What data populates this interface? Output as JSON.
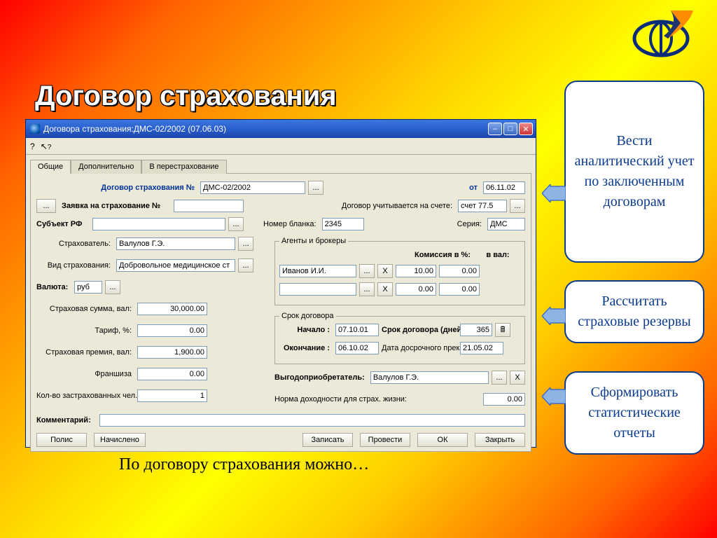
{
  "slide": {
    "title": "Договор страхования",
    "caption": "По договору страхования можно…"
  },
  "callouts": {
    "c1": "Вести аналитический учет по заключенным договорам",
    "c2": "Рассчитать страховые резервы",
    "c3": "Сформировать статистические отчеты"
  },
  "window": {
    "title": "Договора страхования:ДМС-02/2002 (07.06.03)",
    "help_icon": "?",
    "cursor_icon": "↖?"
  },
  "tabs": {
    "t1": "Общие",
    "t2": "Дополнительно",
    "t3": "В перестрахование"
  },
  "labels": {
    "contract_no": "Договор страхования №",
    "from": "от",
    "request_no": "Заявка на страхование №",
    "account": "Договор учитывается на счете:",
    "subject_rf": "Субъект РФ",
    "blank_no": "Номер бланка:",
    "series": "Серия:",
    "insurer": "Страхователь:",
    "type": "Вид страхования:",
    "currency": "Валюта:",
    "sum": "Страховая сумма, вал:",
    "tariff": "Тариф, %:",
    "premium": "Страховая премия, вал:",
    "franchise": "Франшиза",
    "persons": "Кол-во застрахованных чел.",
    "agents_legend": "Агенты и брокеры",
    "commission": "Комиссия в %:",
    "in_currency": "в вал:",
    "term_legend": "Срок договора",
    "start": "Начало :",
    "end": "Окончание :",
    "term_days": "Срок договора (дней):",
    "early_date": "Дата досрочного прекращения:",
    "beneficiary": "Выгодоприобретатель:",
    "yield_norm": "Норма доходности для страх. жизни:",
    "comment": "Комментарий:"
  },
  "values": {
    "contract_no": "ДМС-02/2002",
    "from_date": "06.11.02",
    "request_no": "",
    "account": "счет 77.5",
    "subject_rf": "",
    "blank_no": "2345",
    "series": "ДМС",
    "insurer": "Валулов Г.Э.",
    "type": "Добровольное медицинское ст",
    "currency": "руб",
    "sum": "30,000.00",
    "tariff": "0.00",
    "premium": "1,900.00",
    "franchise": "0.00",
    "persons": "1",
    "agent1_name": "Иванов И.И.",
    "agent1_pct": "10.00",
    "agent1_val": "0.00",
    "agent2_name": "",
    "agent2_pct": "0.00",
    "agent2_val": "0.00",
    "start": "07.10.01",
    "end": "06.10.02",
    "term_days": "365",
    "early_date": "21.05.02",
    "beneficiary": "Валулов Г.Э.",
    "yield_norm": "0.00",
    "comment": ""
  },
  "buttons": {
    "ellipsis": "...",
    "x": "X",
    "polis": "Полис",
    "charged": "Начислено",
    "save": "Записать",
    "post": "Провести",
    "ok": "ОК",
    "close": "Закрыть"
  }
}
